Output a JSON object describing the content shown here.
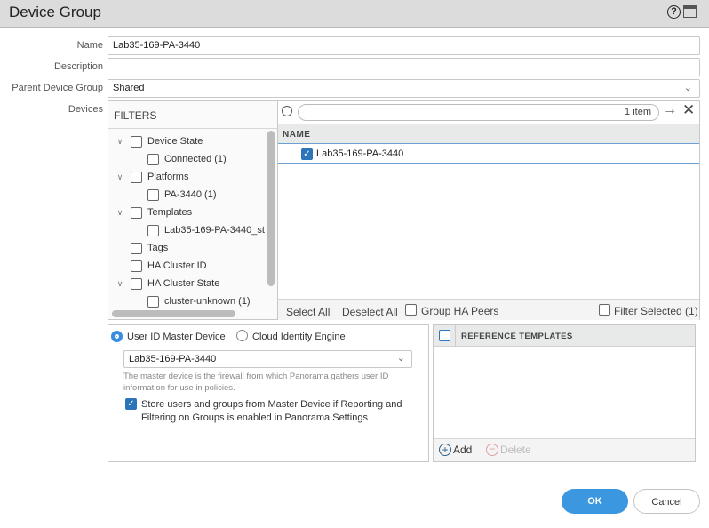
{
  "dialog": {
    "title": "Device Group",
    "help_icon": "help-icon",
    "window_icon": "maximize-icon"
  },
  "form": {
    "name_label": "Name",
    "name_value": "Lab35-169-PA-3440",
    "description_label": "Description",
    "description_value": "",
    "parent_label": "Parent Device Group",
    "parent_value": "Shared",
    "devices_label": "Devices"
  },
  "filters": {
    "header": "FILTERS",
    "items": [
      {
        "label": "Device State",
        "level": 0,
        "expanded": true
      },
      {
        "label": "Connected (1)",
        "level": 1
      },
      {
        "label": "Platforms",
        "level": 0,
        "expanded": true
      },
      {
        "label": "PA-3440 (1)",
        "level": 1
      },
      {
        "label": "Templates",
        "level": 0,
        "expanded": true
      },
      {
        "label": "Lab35-169-PA-3440_st",
        "level": 1
      },
      {
        "label": "Tags",
        "level": 0
      },
      {
        "label": "HA Cluster ID",
        "level": 0
      },
      {
        "label": "HA Cluster State",
        "level": 0,
        "expanded": true
      },
      {
        "label": "cluster-unknown (1)",
        "level": 1
      }
    ]
  },
  "devices": {
    "search_count": "1 item",
    "column": "NAME",
    "rows": [
      {
        "name": "Lab35-169-PA-3440",
        "checked": true
      }
    ],
    "select_all": "Select All",
    "deselect_all": "Deselect All",
    "group_ha_peers": "Group HA Peers",
    "filter_selected": "Filter Selected (1)"
  },
  "userid": {
    "radio_master": "User ID Master Device",
    "radio_cloud": "Cloud Identity Engine",
    "master_value": "Lab35-169-PA-3440",
    "help_text": "The master device is the firewall from which Panorama gathers user ID information for use in policies.",
    "store_label": "Store users and groups from Master Device if Reporting and Filtering on Groups is enabled in Panorama Settings"
  },
  "reference": {
    "header": "REFERENCE TEMPLATES",
    "add": "Add",
    "delete": "Delete"
  },
  "buttons": {
    "ok": "OK",
    "cancel": "Cancel"
  },
  "colors": {
    "accent": "#2c75b9",
    "ok": "#3a97e0"
  }
}
